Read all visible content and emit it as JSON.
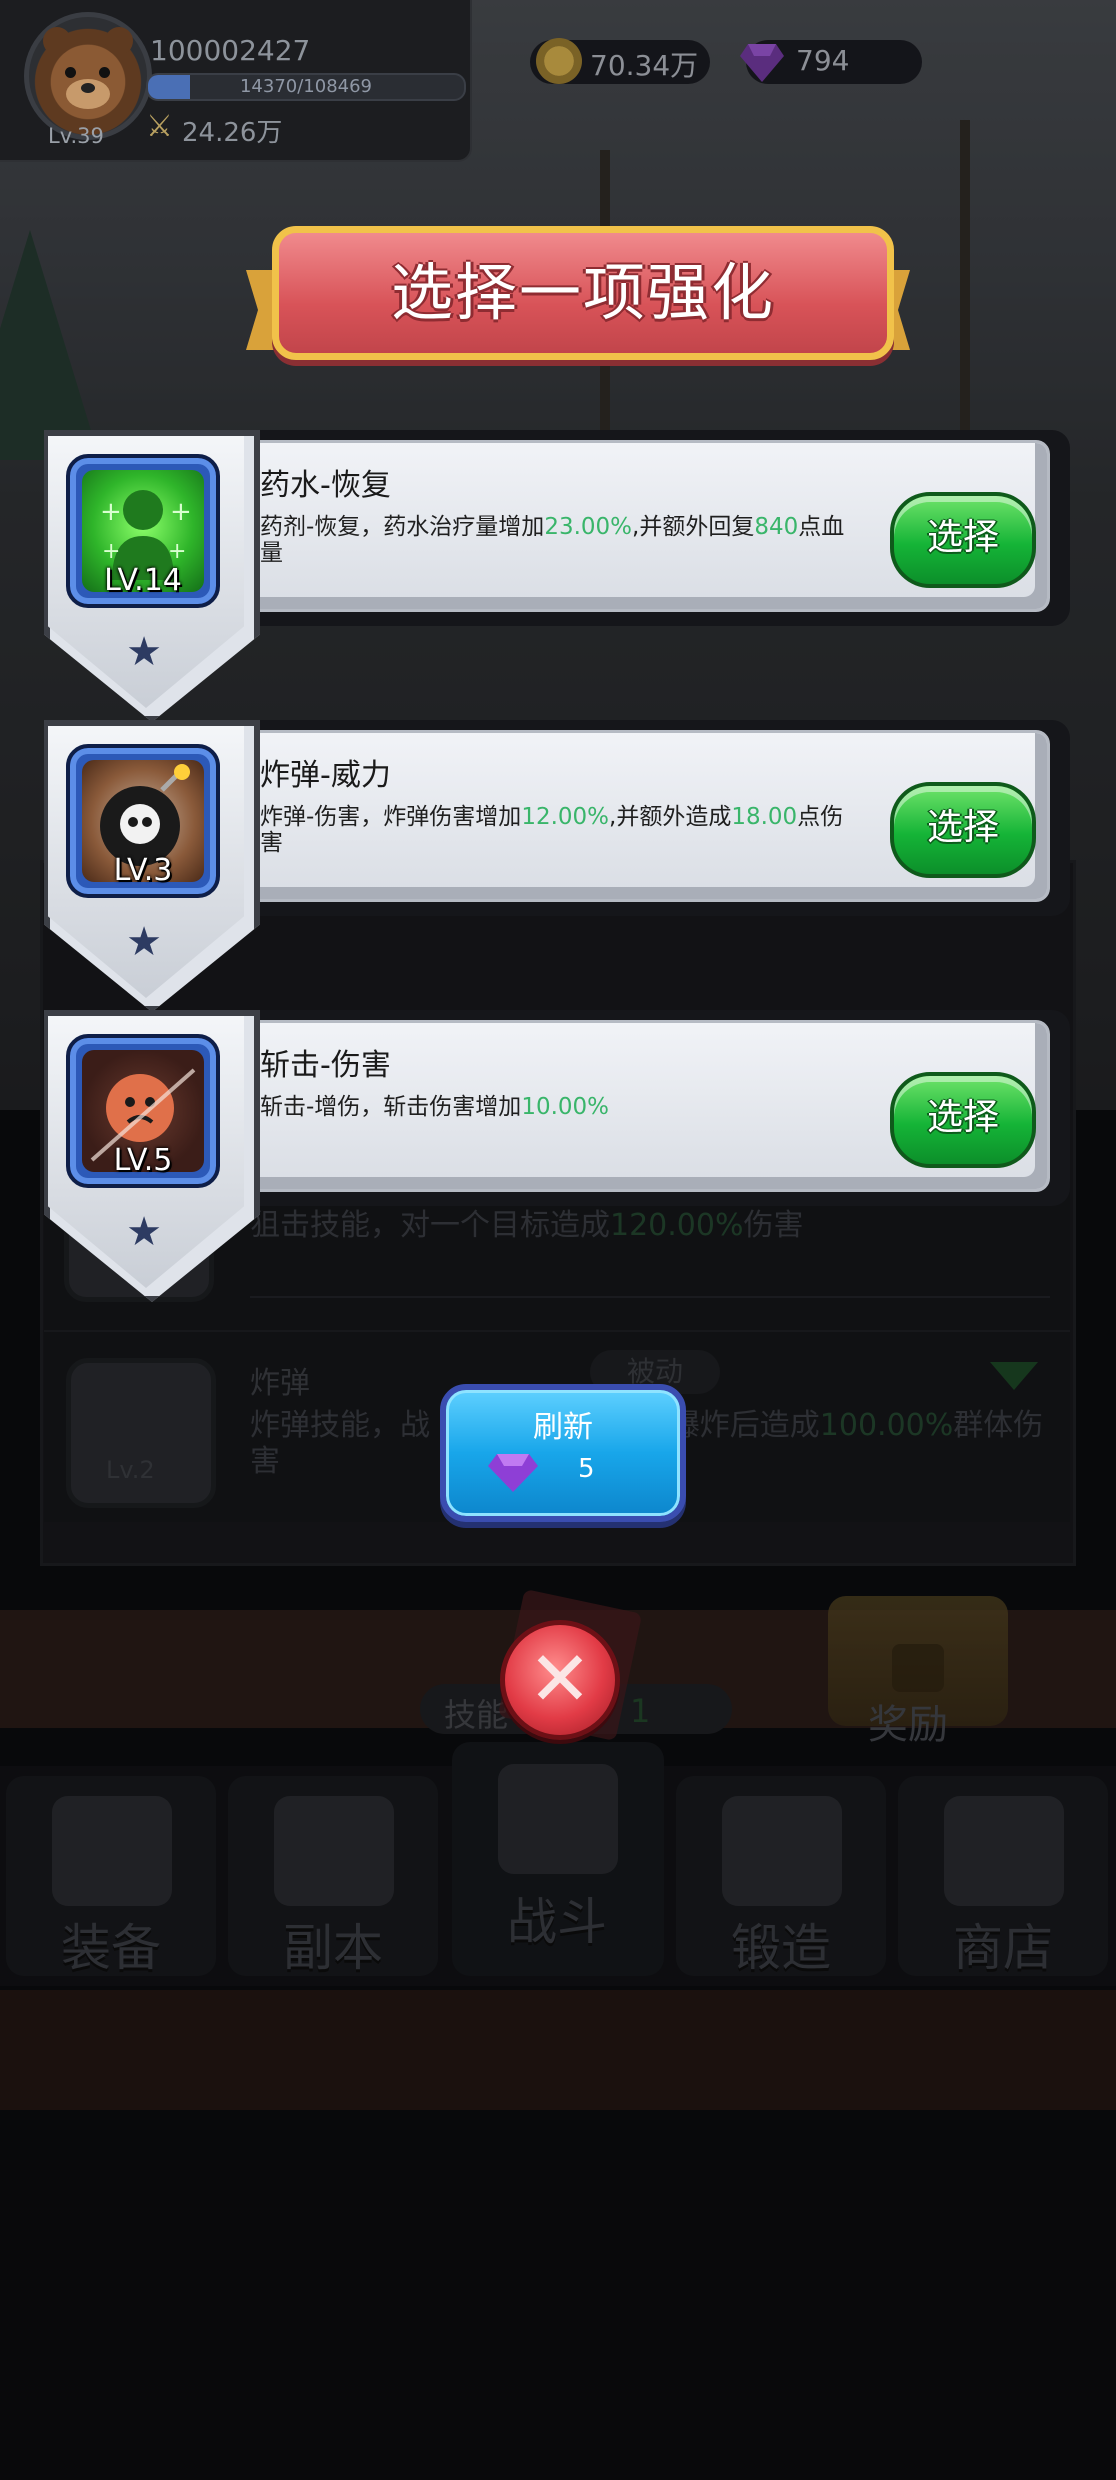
{
  "player": {
    "id": "100002427",
    "level": "Lv.39",
    "xp_text": "14370/108469",
    "xp_fraction": 0.132,
    "power": "24.26万"
  },
  "currency": {
    "coins": "70.34万",
    "gems": "794"
  },
  "dialog": {
    "title": "选择一项强化",
    "options": [
      {
        "name": "药水-恢复",
        "level": "LV.14",
        "desc_pre": "药剂-恢复，药水治疗量增加",
        "desc_hl1": "23.00%",
        "desc_mid": ",并额外回复",
        "desc_hl2": "840",
        "desc_post": "点血量",
        "button": "选择",
        "icon": "potion-heal-icon"
      },
      {
        "name": "炸弹-威力",
        "level": "LV.3",
        "desc_pre": "炸弹-伤害，炸弹伤害增加",
        "desc_hl1": "12.00%",
        "desc_mid": ",并额外造成",
        "desc_hl2": "18.00",
        "desc_post": "点伤害",
        "button": "选择",
        "icon": "skull-bomb-icon"
      },
      {
        "name": "斩击-伤害",
        "level": "LV.5",
        "desc_pre": "斩击-增伤，斩击伤害增加",
        "desc_hl1": "10.00%",
        "desc_mid": "",
        "desc_hl2": "",
        "desc_post": "",
        "button": "选择",
        "icon": "slash-monster-icon"
      }
    ],
    "refresh": {
      "label": "刷新",
      "cost": "5"
    }
  },
  "background_list": {
    "sniper_desc_pre": "狙击技能，对一个目标造成",
    "sniper_desc_hl": "120.00%",
    "sniper_desc_post": "伤害",
    "bomb_name": "炸弹",
    "bomb_tag": "被动",
    "bomb_desc_pre": "炸弹技能，战",
    "bomb_desc_mid": "，爆炸后造成",
    "bomb_desc_hl": "100.00%",
    "bomb_desc_post": "群体伤害",
    "bomb_level": "Lv.2"
  },
  "bottom": {
    "skill_label": "技能",
    "skill_count": "1",
    "reward_label": "奖励",
    "nav": [
      "装备",
      "副本",
      "战斗",
      "锻造",
      "商店"
    ]
  },
  "colors": {
    "accent_green": "#39b56a",
    "banner_red": "#d85358",
    "select_green": "#15b437",
    "refresh_blue": "#18a6ea"
  }
}
